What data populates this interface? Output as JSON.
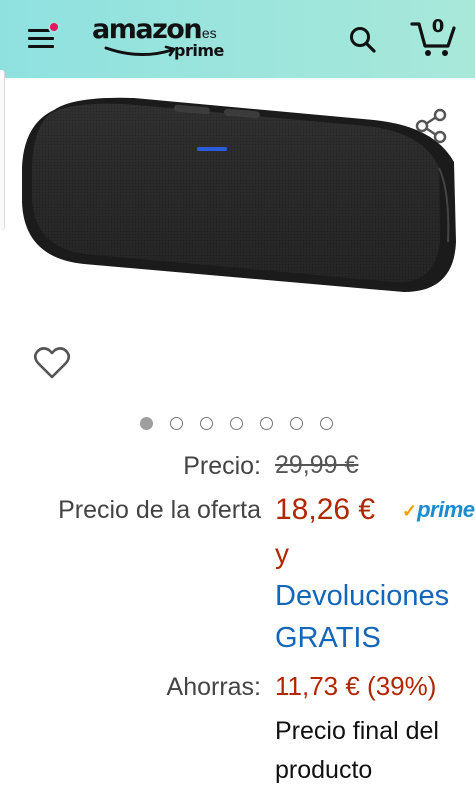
{
  "header": {
    "logo_main": "amazon",
    "logo_domain": ".es",
    "logo_sub": "prime",
    "cart_count": "0",
    "icons": [
      "menu-icon",
      "notification-dot",
      "search-icon",
      "cart-icon"
    ],
    "notification_color": "#e7145f"
  },
  "product": {
    "image_icon": "bluetooth-speaker-image",
    "share_icon": "share-icon",
    "wishlist_icon": "heart-icon",
    "carousel": {
      "count": 7,
      "active": 1
    }
  },
  "price": {
    "list_label": "Precio:",
    "list_value": "29,99 €",
    "deal_label": "Precio de la oferta",
    "deal_value": "18,26 €",
    "prime_check": "✓",
    "prime_text": "prime",
    "conjunction": "y",
    "returns_line1": "Devoluciones",
    "returns_line2": "GRATIS",
    "savings_label": "Ahorras:",
    "savings_value": "11,73 € (39%)",
    "final_line1": "Precio final del",
    "final_line2": "producto"
  },
  "colors": {
    "header_bg": "#9fe4dc",
    "price_red": "#b12704",
    "link_blue": "#1466b8",
    "prime_blue": "#1a8ccf",
    "prime_check": "#f0a100"
  }
}
